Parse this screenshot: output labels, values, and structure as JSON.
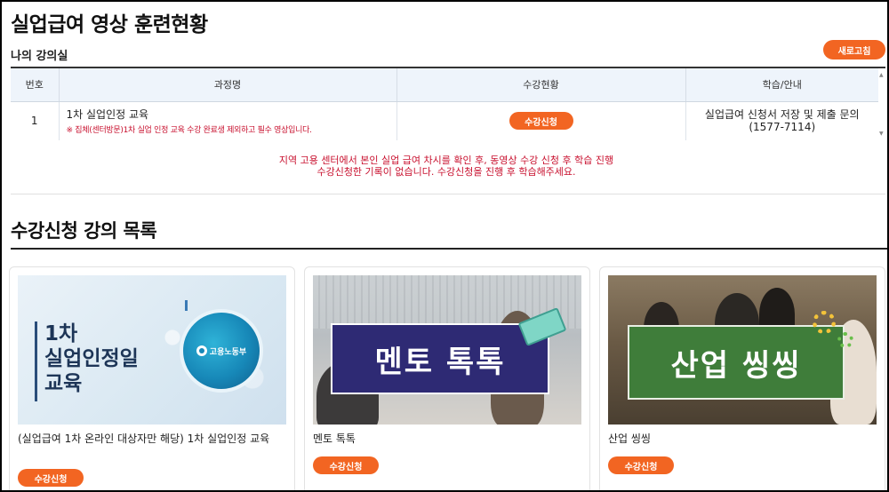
{
  "header": {
    "title": "실업급여 영상 훈련현황",
    "subtitle": "나의 강의실",
    "refresh_label": "새로고침"
  },
  "lecture_table": {
    "columns": [
      "번호",
      "과정명",
      "수강현황",
      "학습/안내"
    ],
    "rows": [
      {
        "number": "1",
        "course_name": "1차 실업인정 교육",
        "course_note": "※ 집체(센터방문)1차 실업 인정 교육 수강 완료생 제외하고 필수 영상입니다.",
        "status_button": "수강신청",
        "guide_line1": "실업급여 신청서 저장 및 제출 문의",
        "guide_line2": "(1577-7114)"
      }
    ]
  },
  "notice": {
    "line1": "지역 고용 센터에서 본인 실업 급여 차시를 확인 후, 동영상 수강 신청 후 학습 진행",
    "line2": "수강신청한 기록이 없습니다. 수강신청을 진행 후 학습해주세요."
  },
  "course_list": {
    "title": "수강신청 강의 목록",
    "cards": [
      {
        "thumb_line1": "1차",
        "thumb_line2": "실업인정일",
        "thumb_line3": "교육",
        "thumb_logo": "고용노동부",
        "title": "(실업급여 1차 온라인 대상자만 해당) 1차 실업인정 교육",
        "button": "수강신청"
      },
      {
        "thumb_text": "멘토 톡톡",
        "title": "멘토 톡톡",
        "button": "수강신청"
      },
      {
        "thumb_text": "산업 씽씽",
        "title": "산업 씽씽",
        "button": "수강신청"
      }
    ]
  },
  "colors": {
    "accent": "#f26522",
    "alert_text": "#c8102e",
    "table_header_bg": "#eef4fb"
  },
  "icons": {
    "scroll_up": "scroll-up-arrow-icon",
    "scroll_down": "scroll-down-arrow-icon"
  }
}
